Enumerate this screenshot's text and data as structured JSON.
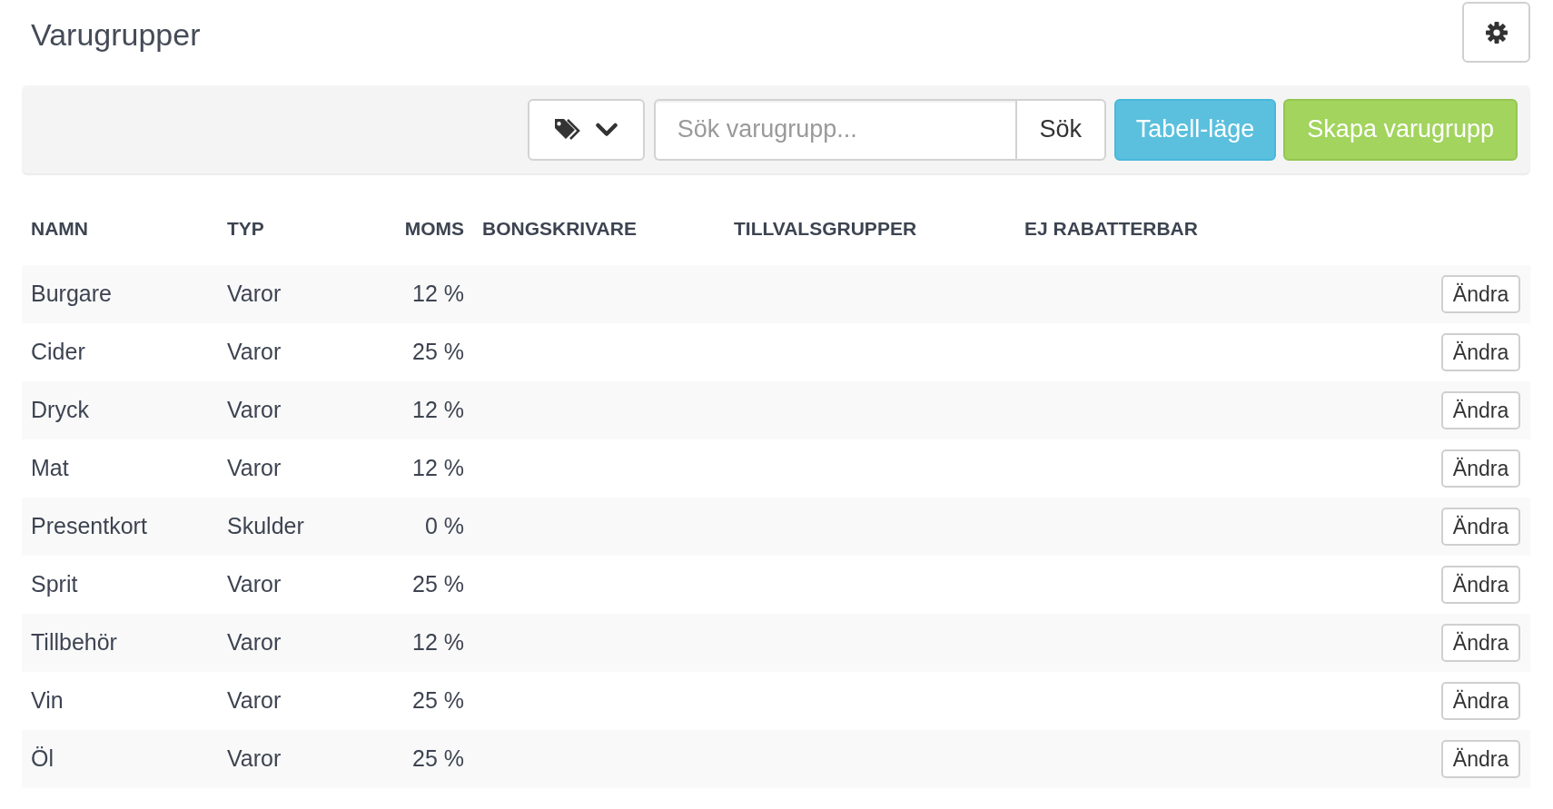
{
  "page": {
    "title": "Varugrupper"
  },
  "toolbar": {
    "search": {
      "placeholder": "Sök varugrupp...",
      "button": "Sök"
    },
    "buttons": [
      {
        "label": "Tabell-läge",
        "kind": "info"
      },
      {
        "label": "Skapa varugrupp",
        "kind": "success"
      }
    ]
  },
  "table": {
    "columns": [
      "NAMN",
      "TYP",
      "MOMS",
      "BONGSKRIVARE",
      "TILLVALSGRUPPER",
      "EJ RABATTERBAR"
    ],
    "rows": [
      {
        "name": "Burgare",
        "type": "Varor",
        "vat": "12 %",
        "action": "Ändra"
      },
      {
        "name": "Cider",
        "type": "Varor",
        "vat": "25 %",
        "action": "Ändra"
      },
      {
        "name": "Dryck",
        "type": "Varor",
        "vat": "12 %",
        "action": "Ändra"
      },
      {
        "name": "Mat",
        "type": "Varor",
        "vat": "12 %",
        "action": "Ändra"
      },
      {
        "name": "Presentkort",
        "type": "Skulder",
        "vat": "0 %",
        "action": "Ändra"
      },
      {
        "name": "Sprit",
        "type": "Varor",
        "vat": "25 %",
        "action": "Ändra"
      },
      {
        "name": "Tillbehör",
        "type": "Varor",
        "vat": "12 %",
        "action": "Ändra"
      },
      {
        "name": "Vin",
        "type": "Varor",
        "vat": "25 %",
        "action": "Ändra"
      },
      {
        "name": "Öl",
        "type": "Varor",
        "vat": "25 %",
        "action": "Ändra"
      }
    ]
  }
}
